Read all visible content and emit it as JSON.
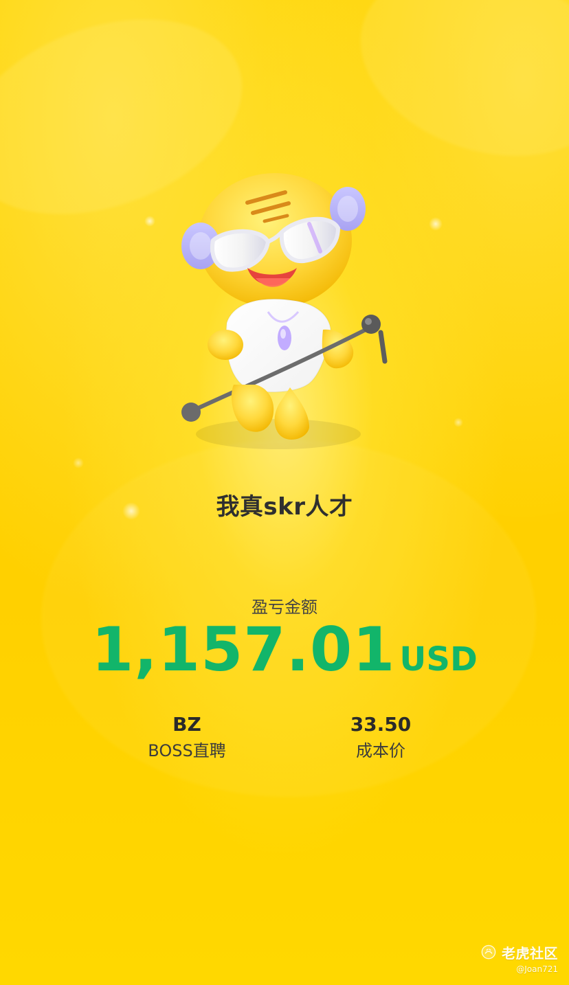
{
  "header": {
    "title": "我真skr人才"
  },
  "pnl": {
    "label": "盈亏金额",
    "amount": "1,157.01",
    "currency": "USD",
    "color": "#12B56A"
  },
  "stats": [
    {
      "value": "BZ",
      "label": "BOSS直聘"
    },
    {
      "value": "33.50",
      "label": "成本价"
    }
  ],
  "watermark": {
    "brand": "老虎社区",
    "user": "@Joan721"
  },
  "mascot": {
    "icon": "tiger-mascot-singing-icon"
  },
  "theme": {
    "background": "#FFD200"
  }
}
